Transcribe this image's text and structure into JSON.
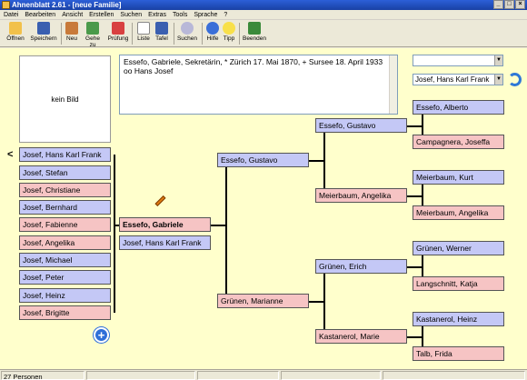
{
  "window": {
    "title": "Ahnenblatt 2.61 - [neue Familie]"
  },
  "menu": [
    "Datei",
    "Bearbeiten",
    "Ansicht",
    "Erstellen",
    "Suchen",
    "Extras",
    "Tools",
    "Sprache",
    "?"
  ],
  "toolbar": {
    "open": "Öffnen",
    "save": "Speichern",
    "new": "Neu",
    "goto": "Gehe zu",
    "check": "Prüfung",
    "list": "Liste",
    "table": "Tafel",
    "search": "Suchen",
    "help": "Hilfe",
    "tip": "Tipp",
    "exit": "Beenden"
  },
  "photo": {
    "placeholder": "kein Bild"
  },
  "info": {
    "line1": "Essefo, Gabriele, Sekretärin, * Zürich 17. Mai 1870, + Sursee 18. April 1933",
    "line2": "oo Hans Josef"
  },
  "selector": {
    "value1": "",
    "value2": "Josef, Hans Karl Frank"
  },
  "children": [
    "Josef, Hans Karl Frank",
    "Josef, Stefan",
    "Josef, Christiane",
    "Josef, Bernhard",
    "Josef, Fabienne",
    "Josef, Angelika",
    "Josef, Michael",
    "Josef, Peter",
    "Josef, Heinz",
    "Josef, Brigitte"
  ],
  "person": {
    "selected": "Essefo, Gabriele",
    "spouse": "Josef, Hans Karl Frank"
  },
  "parents": {
    "father": "Essefo, Gustavo",
    "mother": "Grünen, Marianne"
  },
  "grandparents": {
    "pat_father": "Essefo, Gustavo",
    "pat_mother": "Meierbaum, Angelika",
    "mat_father": "Grünen, Erich",
    "mat_mother": "Kastanerol, Marie"
  },
  "greatgrandparents": [
    "Essefo, Alberto",
    "Campagnera, Joseffa",
    "Meierbaum, Kurt",
    "Meierbaum, Angelika",
    "Grünen, Werner",
    "Langschnitt, Katja",
    "Kastanerol, Heinz",
    "Talb, Frida"
  ],
  "status": {
    "count": "27 Personen"
  },
  "colors": {
    "male": "#c4c8f6",
    "female": "#f6c4c4",
    "background": "#ffffcc"
  }
}
